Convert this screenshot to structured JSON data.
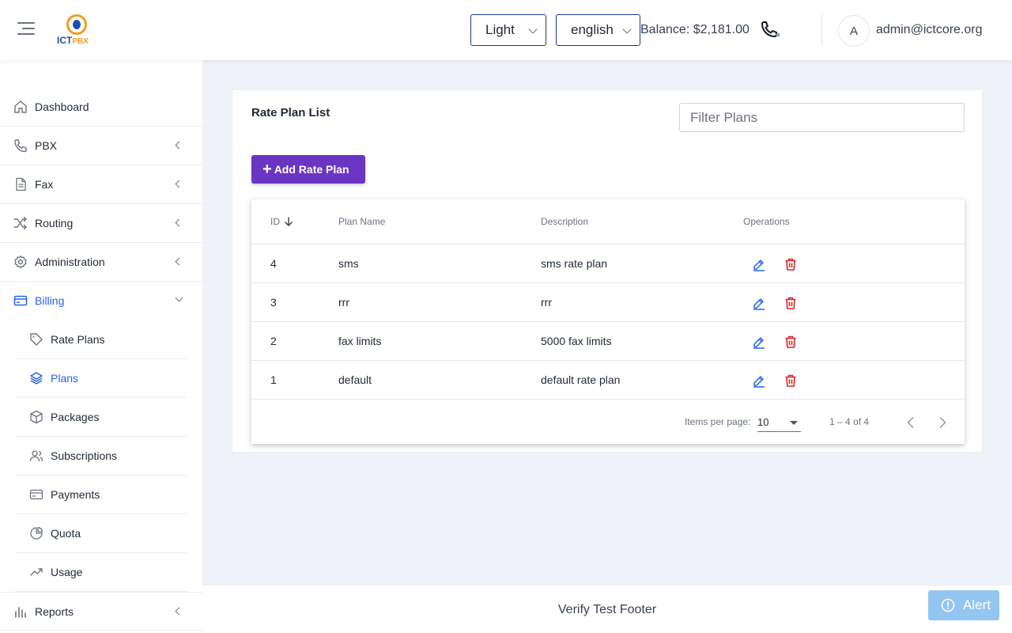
{
  "header": {
    "theme_value": "Light",
    "language_value": "english",
    "balance": "Balance: $2,181.00",
    "avatar_letter": "A",
    "user_email": "admin@ictcore.org",
    "logo_text_main": "ICT",
    "logo_text_pbx": "PBX"
  },
  "sidebar": {
    "items": [
      {
        "label": "Dashboard",
        "icon": "home-icon"
      },
      {
        "label": "PBX",
        "icon": "phone-icon"
      },
      {
        "label": "Fax",
        "icon": "document-icon"
      },
      {
        "label": "Routing",
        "icon": "shuffle-icon"
      },
      {
        "label": "Administration",
        "icon": "gear-icon"
      },
      {
        "label": "Billing",
        "icon": "credit-card-icon"
      },
      {
        "label": "Reports",
        "icon": "bar-chart-icon"
      }
    ],
    "billing_sub": [
      {
        "label": "Rate Plans",
        "icon": "tag-icon"
      },
      {
        "label": "Plans",
        "icon": "layers-icon"
      },
      {
        "label": "Packages",
        "icon": "box-icon"
      },
      {
        "label": "Subscriptions",
        "icon": "users-icon"
      },
      {
        "label": "Payments",
        "icon": "card-icon"
      },
      {
        "label": "Quota",
        "icon": "pie-chart-icon"
      },
      {
        "label": "Usage",
        "icon": "trending-up-icon"
      }
    ]
  },
  "main": {
    "title": "Rate Plan List",
    "filter_placeholder": "Filter Plans",
    "add_button": "Add Rate Plan",
    "columns": [
      "ID",
      "Plan Name",
      "Description",
      "Operations"
    ],
    "rows": [
      {
        "id": "4",
        "name": "sms",
        "description": "sms rate plan"
      },
      {
        "id": "3",
        "name": "rrr",
        "description": "rrr"
      },
      {
        "id": "2",
        "name": "fax limits",
        "description": "5000 fax limits"
      },
      {
        "id": "1",
        "name": "default",
        "description": "default rate plan"
      }
    ],
    "paginator": {
      "items_per_page_label": "Items per page:",
      "items_per_page": "10",
      "range": "1 – 4 of 4"
    }
  },
  "footer": {
    "text": "Verify Test Footer",
    "alert_label": "Alert"
  },
  "colors": {
    "accent": "#2563eb",
    "add_button": "#6a35c2",
    "delete": "#dc2626",
    "alert": "#93c5f1"
  }
}
